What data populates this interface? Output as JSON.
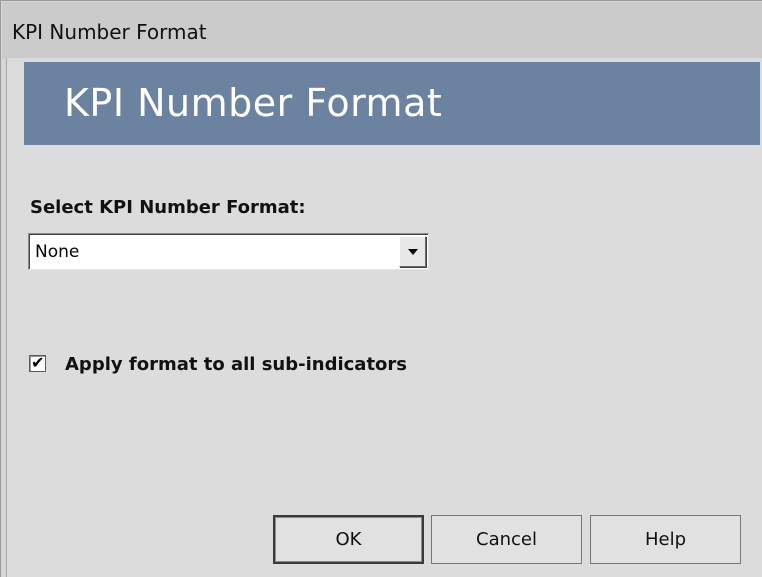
{
  "window": {
    "title": "KPI Number Format"
  },
  "banner": {
    "title": "KPI Number Format"
  },
  "format_select": {
    "label": "Select KPI Number Format:",
    "selected_value": "None"
  },
  "apply_checkbox": {
    "label": "Apply format to all sub-indicators",
    "checked": true
  },
  "buttons": {
    "ok": "OK",
    "cancel": "Cancel",
    "help": "Help"
  },
  "colors": {
    "banner_background": "#6b82a0",
    "dialog_background": "#dcdcdc"
  }
}
